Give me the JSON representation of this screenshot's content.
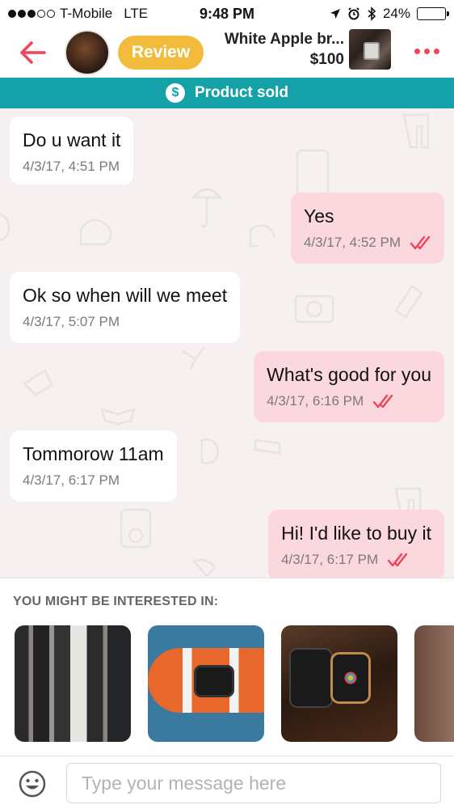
{
  "status_bar": {
    "carrier": "T-Mobile",
    "network": "LTE",
    "time": "9:48 PM",
    "battery": "24%",
    "battery_level": 0.24
  },
  "header": {
    "review_label": "Review",
    "product_title": "White Apple br...",
    "product_price": "$100"
  },
  "banner": {
    "text": "Product sold"
  },
  "messages": [
    {
      "direction": "in",
      "text": "Do u want it",
      "time": "4/3/17, 4:51 PM"
    },
    {
      "direction": "out",
      "text": "Yes",
      "time": "4/3/17, 4:52 PM",
      "read": true
    },
    {
      "direction": "in",
      "text": "Ok so when will we meet",
      "time": "4/3/17, 5:07 PM"
    },
    {
      "direction": "out",
      "text": "What's good for you",
      "time": "4/3/17, 6:16 PM",
      "read": true
    },
    {
      "direction": "in",
      "text": "Tommorow 11am",
      "time": "4/3/17, 6:17 PM"
    },
    {
      "direction": "out",
      "text": "Hi! I'd like to buy it",
      "time": "4/3/17, 6:17 PM",
      "read": true
    }
  ],
  "suggestions": {
    "title": "YOU MIGHT BE INTERESTED IN:"
  },
  "composer": {
    "placeholder": "Type your message here"
  },
  "colors": {
    "accent": "#f0445a",
    "teal": "#15a1a8",
    "review": "#f2bb3c",
    "outgoing_bubble": "#fbd8dd"
  }
}
